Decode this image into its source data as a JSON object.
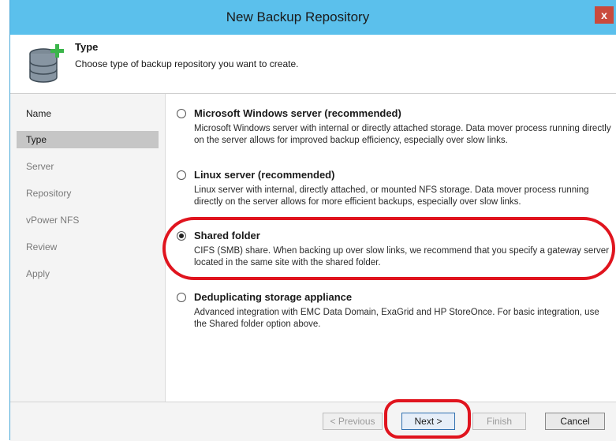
{
  "window": {
    "title": "New Backup Repository",
    "close_label": "x"
  },
  "header": {
    "step_title": "Type",
    "step_description": "Choose type of backup repository you want to create.",
    "icon": "database-add-icon"
  },
  "nav": {
    "items": [
      {
        "label": "Name",
        "state": "done"
      },
      {
        "label": "Type",
        "state": "active"
      },
      {
        "label": "Server",
        "state": "inactive"
      },
      {
        "label": "Repository",
        "state": "inactive"
      },
      {
        "label": "vPower NFS",
        "state": "inactive"
      },
      {
        "label": "Review",
        "state": "inactive"
      },
      {
        "label": "Apply",
        "state": "inactive"
      }
    ]
  },
  "options": [
    {
      "label": "Microsoft Windows server (recommended)",
      "description": "Microsoft Windows server with internal or directly attached storage. Data mover process running directly on the server allows for improved backup efficiency, especially over slow links.",
      "selected": false
    },
    {
      "label": "Linux server (recommended)",
      "description": "Linux server with internal, directly attached, or mounted NFS storage. Data mover process running directly on the server allows for more efficient backups, especially over slow links.",
      "selected": false
    },
    {
      "label": "Shared folder",
      "description": "CIFS (SMB) share. When backing up over slow links, we recommend that you specify a gateway server located in the same site with the shared folder.",
      "selected": true
    },
    {
      "label": "Deduplicating storage appliance",
      "description": "Advanced integration with EMC Data Domain, ExaGrid and HP StoreOnce. For basic integration, use the Shared folder option above.",
      "selected": false
    }
  ],
  "footer": {
    "previous_label": "< Previous",
    "next_label": "Next >",
    "finish_label": "Finish",
    "cancel_label": "Cancel"
  },
  "colors": {
    "titlebar": "#5bc0ec",
    "highlight": "#e0141e",
    "nav_active": "#c6c6c6"
  }
}
